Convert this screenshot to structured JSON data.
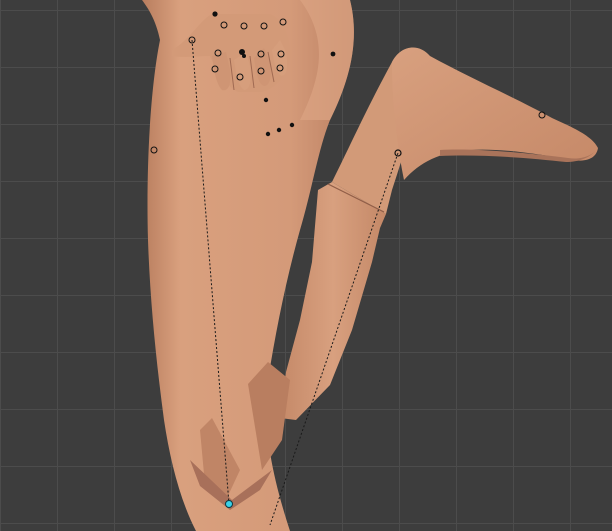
{
  "app": {
    "view": "3D Viewport"
  },
  "scene": {
    "subject": "posed-leg-figure",
    "colors": {
      "background": "#3d3d3d",
      "grid_line": "#4c4c4c",
      "skin_light": "#d9a07e",
      "skin_mid": "#c98c6b",
      "skin_shadow": "#9e6a52",
      "rig_point": "#111111",
      "selected_point": "#3ad1e8",
      "relationship_line": "#1a1a1a"
    },
    "icons": {
      "ik_target": "crosshair-circle-icon",
      "selected": "selected-pivot-icon"
    }
  }
}
